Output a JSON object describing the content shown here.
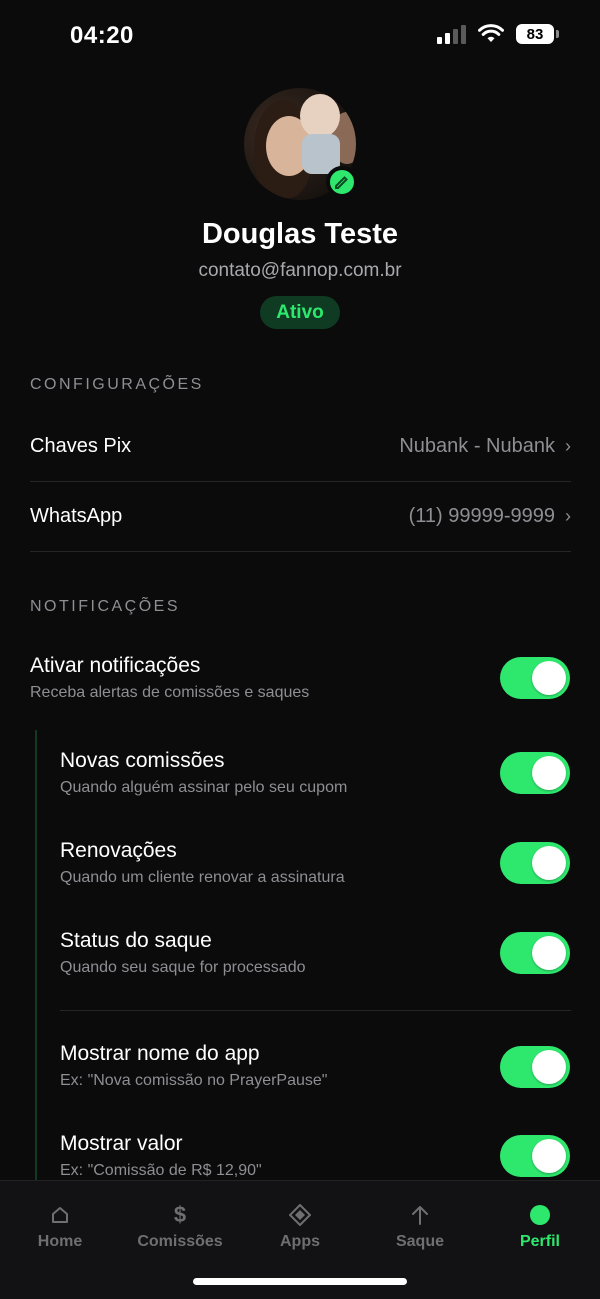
{
  "status_bar": {
    "time": "04:20",
    "battery": "83"
  },
  "profile": {
    "name": "Douglas Teste",
    "email": "contato@fannop.com.br",
    "status": "Ativo"
  },
  "settings": {
    "title": "CONFIGURAÇÕES",
    "items": [
      {
        "label": "Chaves Pix",
        "value": "Nubank - Nubank"
      },
      {
        "label": "WhatsApp",
        "value": "(11) 99999-9999"
      }
    ]
  },
  "notifications": {
    "title": "NOTIFICAÇÕES",
    "main": {
      "title": "Ativar notificações",
      "sub": "Receba alertas de comissões e saques",
      "enabled": true
    },
    "items": [
      {
        "title": "Novas comissões",
        "sub": "Quando alguém assinar pelo seu cupom",
        "enabled": true
      },
      {
        "title": "Renovações",
        "sub": "Quando um cliente renovar a assinatura",
        "enabled": true
      },
      {
        "title": "Status do saque",
        "sub": "Quando seu saque for processado",
        "enabled": true
      },
      {
        "title": "Mostrar nome do app",
        "sub": "Ex: \"Nova comissão no PrayerPause\"",
        "enabled": true
      },
      {
        "title": "Mostrar valor",
        "sub": "Ex: \"Comissão de R$ 12,90\"",
        "enabled": true
      }
    ]
  },
  "tabs": [
    {
      "label": "Home",
      "icon": "house-icon"
    },
    {
      "label": "Comissões",
      "icon": "dollar-icon"
    },
    {
      "label": "Apps",
      "icon": "diamond-icon"
    },
    {
      "label": "Saque",
      "icon": "arrow-up-icon"
    },
    {
      "label": "Perfil",
      "icon": "dot-icon",
      "active": true
    }
  ],
  "colors": {
    "accent": "#2ee86e",
    "background": "#0b0b0c",
    "muted": "#8e8e93"
  }
}
